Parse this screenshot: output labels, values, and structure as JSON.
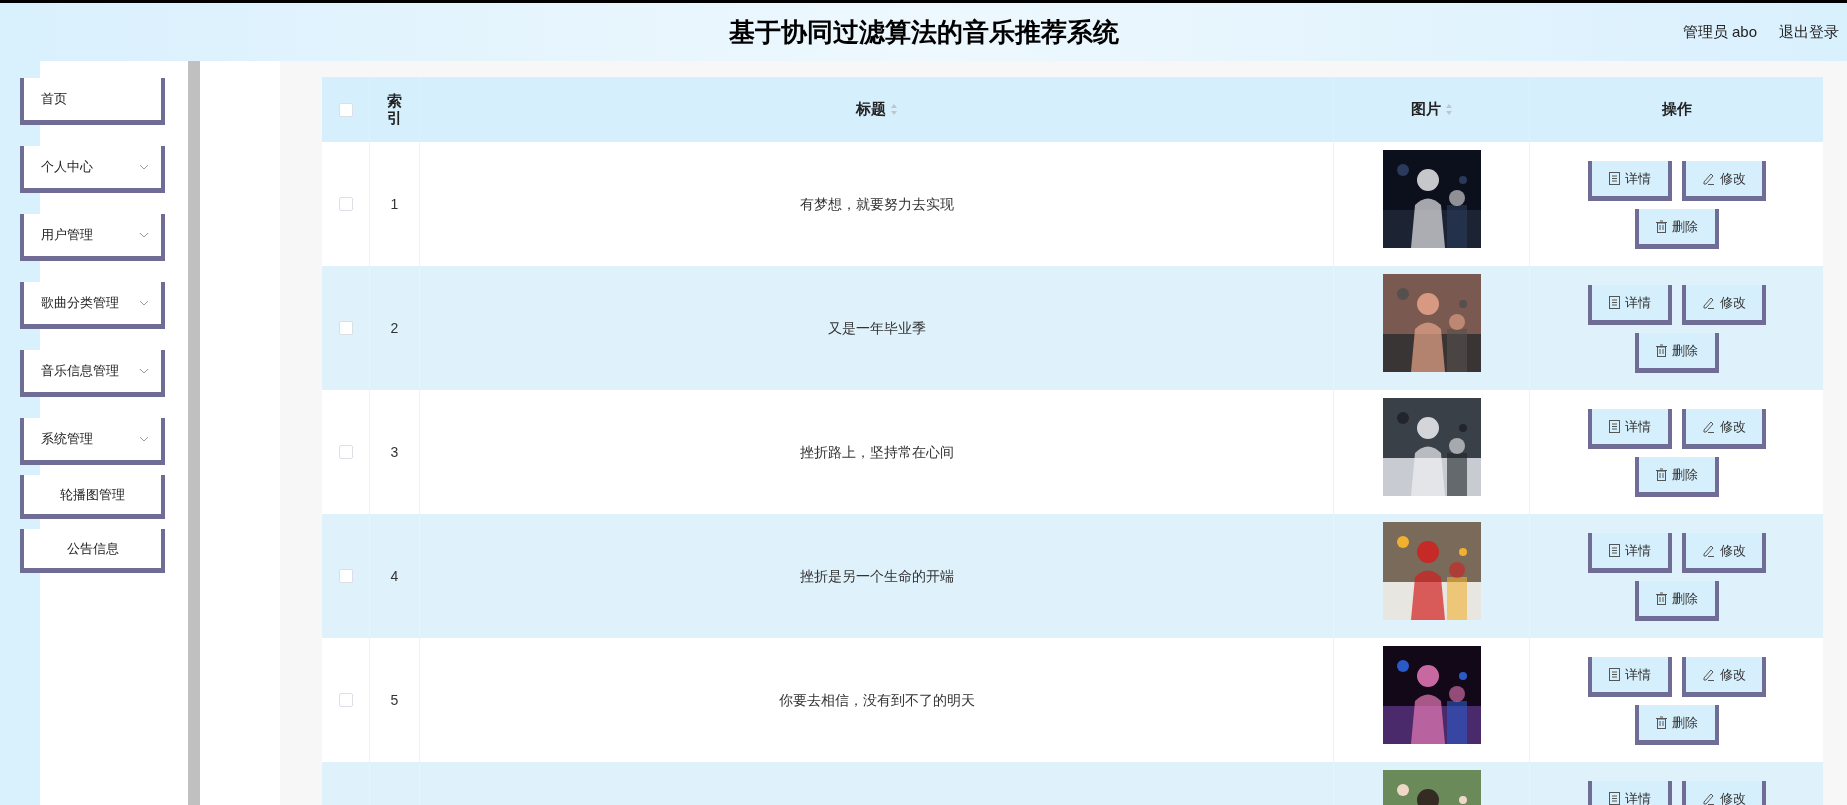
{
  "header": {
    "title": "基于协同过滤算法的音乐推荐系统",
    "user": "管理员 abo",
    "logout": "退出登录"
  },
  "sidebar": {
    "items": [
      {
        "label": "首页",
        "expandable": false
      },
      {
        "label": "个人中心",
        "expandable": true
      },
      {
        "label": "用户管理",
        "expandable": true
      },
      {
        "label": "歌曲分类管理",
        "expandable": true
      },
      {
        "label": "音乐信息管理",
        "expandable": true
      },
      {
        "label": "系统管理",
        "expandable": true
      },
      {
        "label": "轮播图管理",
        "expandable": false
      },
      {
        "label": "公告信息",
        "expandable": false
      }
    ]
  },
  "table": {
    "select_all": {
      "checked": false
    },
    "columns": [
      {
        "label": "索引",
        "sortable": false
      },
      {
        "label": "标题",
        "sortable": true
      },
      {
        "label": "图片",
        "sortable": true
      },
      {
        "label": "操作",
        "sortable": false
      }
    ],
    "rows": [
      {
        "checked": false,
        "index": "1",
        "title": "有梦想，就要努力去实现",
        "picture": {
          "kind": "picture"
        },
        "actions": [
          {
            "kind": "detail",
            "label": "详情"
          },
          {
            "kind": "edit",
            "label": "修改"
          },
          {
            "kind": "delete",
            "label": "删除"
          }
        ]
      },
      {
        "checked": false,
        "index": "2",
        "title": "又是一年毕业季",
        "picture": {
          "kind": "picture"
        },
        "actions": [
          {
            "kind": "detail",
            "label": "详情"
          },
          {
            "kind": "edit",
            "label": "修改"
          },
          {
            "kind": "delete",
            "label": "删除"
          }
        ]
      },
      {
        "checked": false,
        "index": "3",
        "title": "挫折路上，坚持常在心间",
        "picture": {
          "kind": "picture"
        },
        "actions": [
          {
            "kind": "detail",
            "label": "详情"
          },
          {
            "kind": "edit",
            "label": "修改"
          },
          {
            "kind": "delete",
            "label": "删除"
          }
        ]
      },
      {
        "checked": false,
        "index": "4",
        "title": "挫折是另一个生命的开端",
        "picture": {
          "kind": "picture"
        },
        "actions": [
          {
            "kind": "detail",
            "label": "详情"
          },
          {
            "kind": "edit",
            "label": "修改"
          },
          {
            "kind": "delete",
            "label": "删除"
          }
        ]
      },
      {
        "checked": false,
        "index": "5",
        "title": "你要去相信，没有到不了的明天",
        "picture": {
          "kind": "picture"
        },
        "actions": [
          {
            "kind": "detail",
            "label": "详情"
          },
          {
            "kind": "edit",
            "label": "修改"
          },
          {
            "kind": "delete",
            "label": "删除"
          }
        ]
      },
      {
        "picture": {
          "kind": "picture"
        },
        "actions": [
          {
            "kind": "detail",
            "label": "详情"
          },
          {
            "kind": "edit",
            "label": "修改"
          }
        ]
      }
    ]
  }
}
